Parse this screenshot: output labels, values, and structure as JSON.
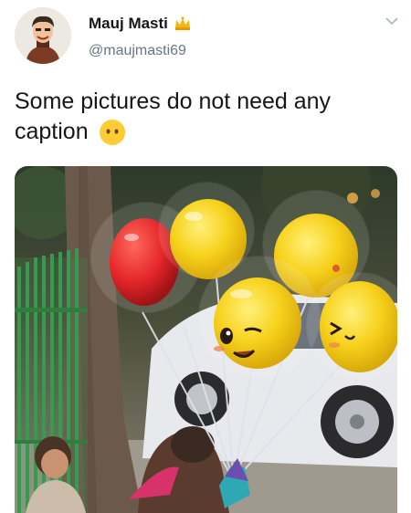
{
  "tweet": {
    "display_name": "Mauj Masti",
    "handle": "@maujmasti69",
    "text": "Some pictures do not need any caption",
    "caption_emoji": "no-mouth-face-emoji",
    "badge_icon": "crown-icon",
    "menu_icon": "chevron-down-icon"
  },
  "colors": {
    "text": "#14171a",
    "secondary": "#657786",
    "balloon_yellow": "#f7d21c",
    "balloon_red": "#e5262b"
  }
}
